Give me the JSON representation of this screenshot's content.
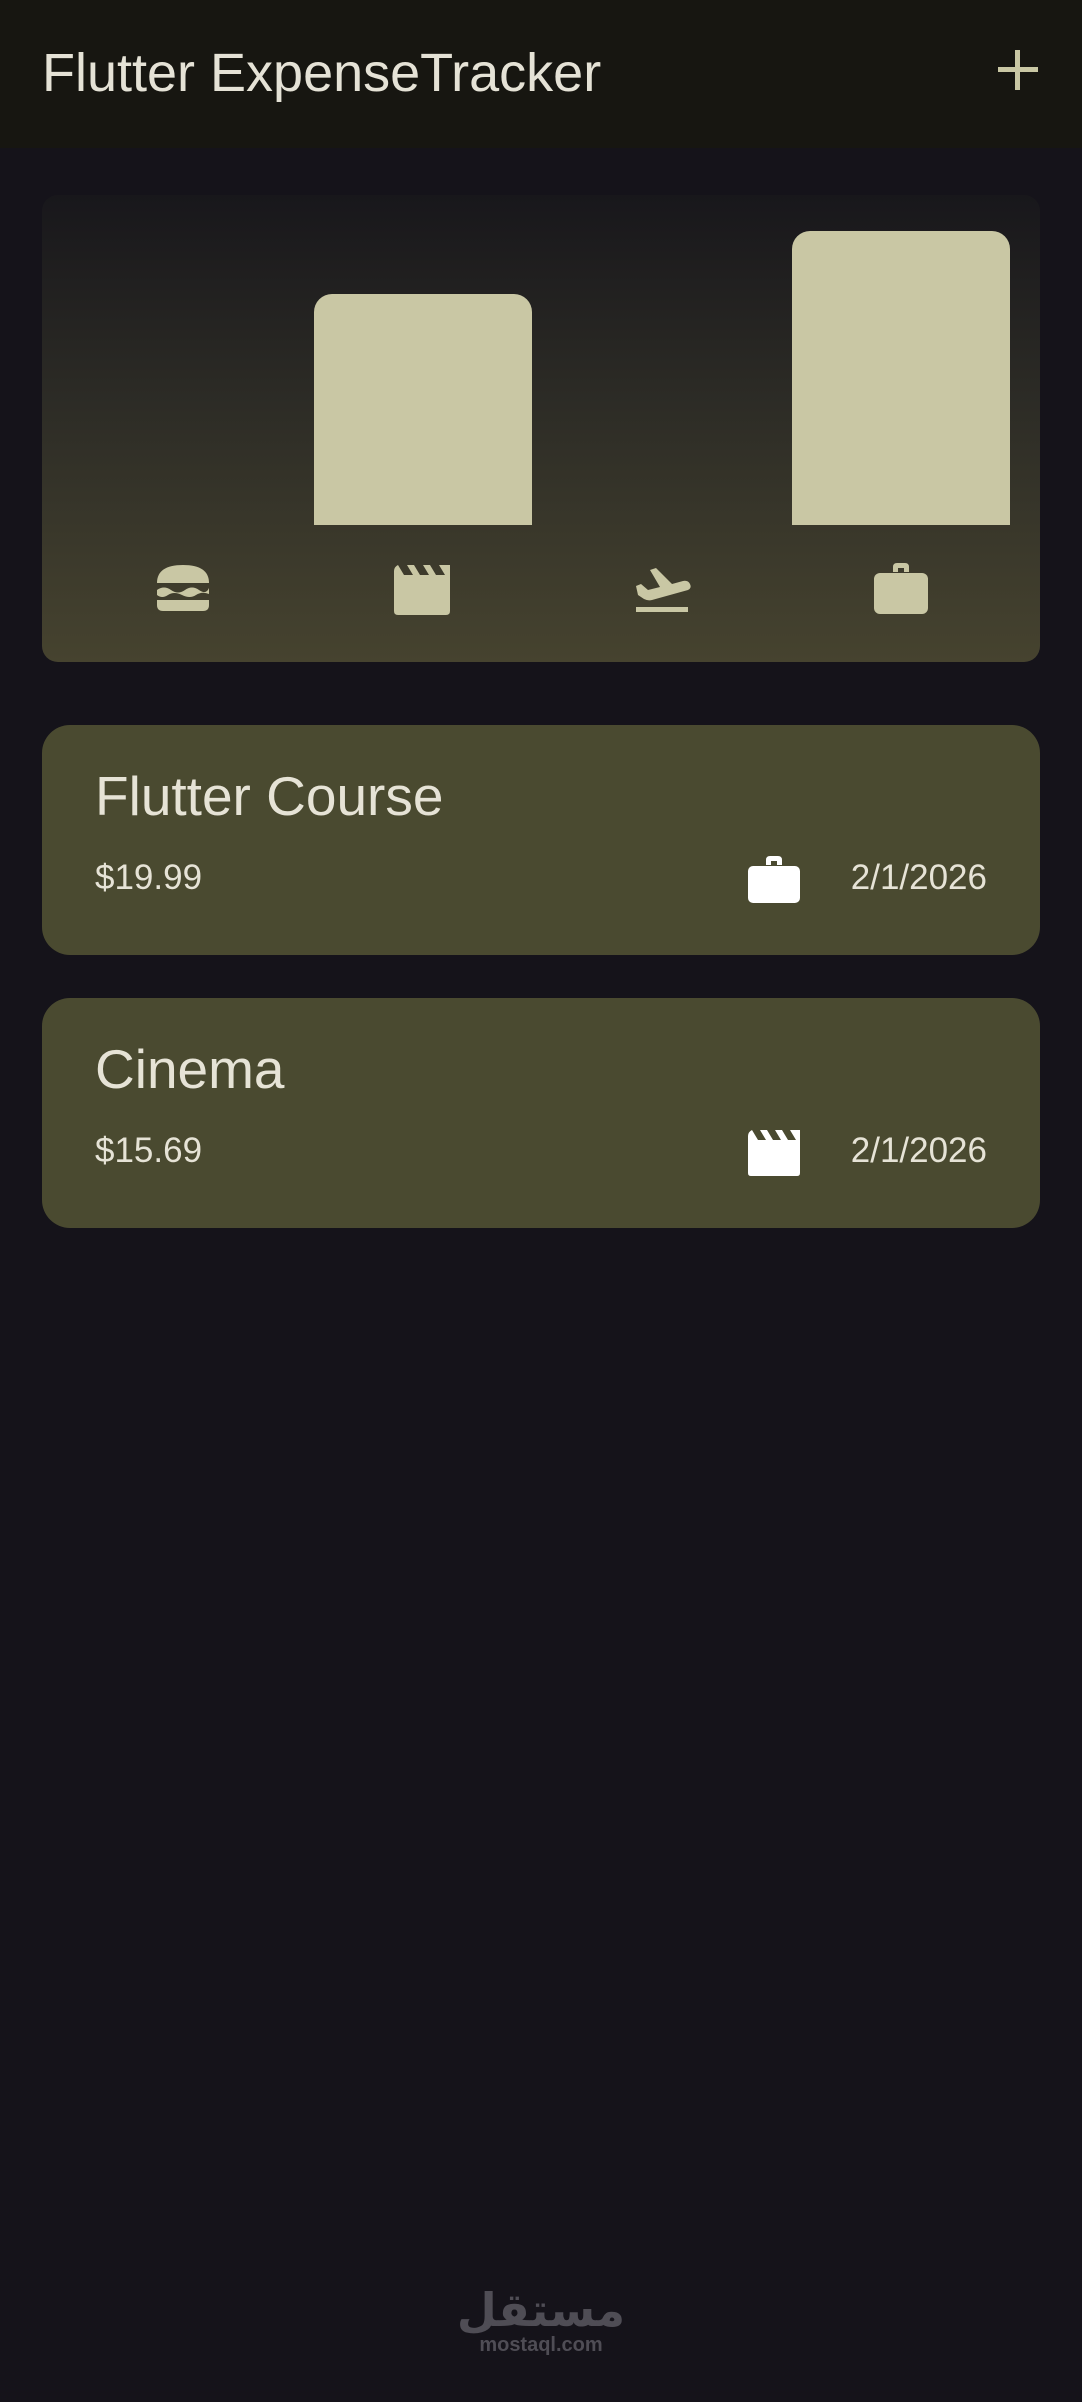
{
  "app_bar": {
    "title": "Flutter ExpenseTracker",
    "add_icon": "plus-icon"
  },
  "colors": {
    "background": "#15131a",
    "app_bar": "#171611",
    "card": "#4a4a30",
    "bar": "#c9c7a4",
    "text": "#e6e3d6"
  },
  "chart_data": {
    "type": "bar",
    "categories": [
      "food",
      "leisure",
      "travel",
      "work"
    ],
    "category_icons": [
      "burger-icon",
      "movie-clapper-icon",
      "flight-takeoff-icon",
      "briefcase-icon"
    ],
    "values": [
      0,
      15.69,
      0,
      19.99
    ],
    "ylim": [
      0,
      19.99
    ]
  },
  "expenses": [
    {
      "title": "Flutter Course",
      "amount": "$19.99",
      "category_icon": "briefcase-icon",
      "date": "2/1/2026"
    },
    {
      "title": "Cinema",
      "amount": "$15.69",
      "category_icon": "movie-clapper-icon",
      "date": "2/1/2026"
    }
  ],
  "watermark": {
    "arabic": "مستقل",
    "latin": "mostaql.com"
  }
}
